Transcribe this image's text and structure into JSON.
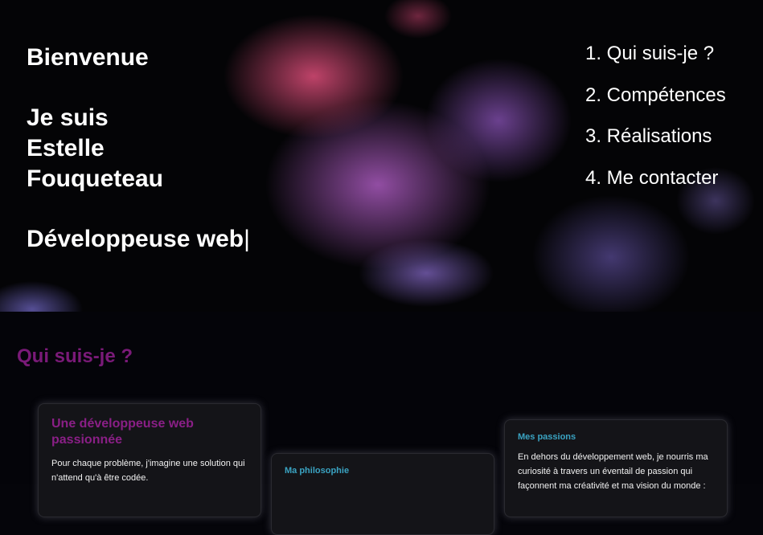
{
  "hero": {
    "greeting": "Bienvenue",
    "name": "Je suis Estelle Fouqueteau",
    "role": "Développeuse web",
    "cursor": "|"
  },
  "nav": {
    "items": [
      {
        "label": "1. Qui suis-je ?"
      },
      {
        "label": "2. Compétences"
      },
      {
        "label": "3. Réalisations"
      },
      {
        "label": "4. Me contacter"
      }
    ]
  },
  "about": {
    "title": "Qui suis-je ?",
    "cards": [
      {
        "title": "Une développeuse web passionnée",
        "text": "Pour chaque problème, j'imagine une solution qui n'attend qu'à être codée."
      },
      {
        "title": "Ma philosophie",
        "text": ""
      },
      {
        "title": "Mes passions",
        "text": "En dehors du développement web, je nourris ma curiosité à travers un éventail de passion qui façonnent ma créativité et ma vision du monde :"
      }
    ]
  },
  "colors": {
    "accent_purple": "#7a1a78",
    "accent_teal": "#3aa3c2",
    "background": "#05050a"
  }
}
